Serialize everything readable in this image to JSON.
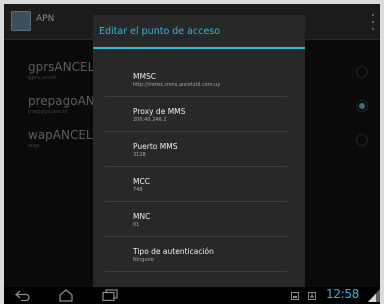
{
  "app_bar": {
    "title": "APN",
    "app_icon": "settings-app-icon",
    "overflow_icon": "overflow-menu-icon"
  },
  "apn_list": [
    {
      "name": "gprsANCEL",
      "subtitle": "gprs.ancel",
      "selected": false
    },
    {
      "name": "prepagoANCEL",
      "subtitle": "prepago.ancel",
      "selected": true
    },
    {
      "name": "wapANCEL",
      "subtitle": "wap",
      "selected": false
    }
  ],
  "dialog": {
    "title": "Editar el punto de acceso",
    "fields": [
      {
        "label": "MMSC",
        "value": "http://mmsc.mms.ancelutil.com.uy"
      },
      {
        "label": "Proxy de MMS",
        "value": "200.40.246.2"
      },
      {
        "label": "Puerto MMS",
        "value": "3128"
      },
      {
        "label": "MCC",
        "value": "748"
      },
      {
        "label": "MNC",
        "value": "01"
      },
      {
        "label": "Tipo de autenticación",
        "value": "Ninguno"
      }
    ],
    "partial_item": "· · ·"
  },
  "nav_bar": {
    "back_icon": "back-icon",
    "home_icon": "home-icon",
    "recents_icon": "recent-apps-icon"
  },
  "status_bar": {
    "time": "12:58",
    "icons": [
      "notification-icon",
      "download-icon",
      "signal-icon"
    ],
    "accent_color": "#33b5e5"
  }
}
